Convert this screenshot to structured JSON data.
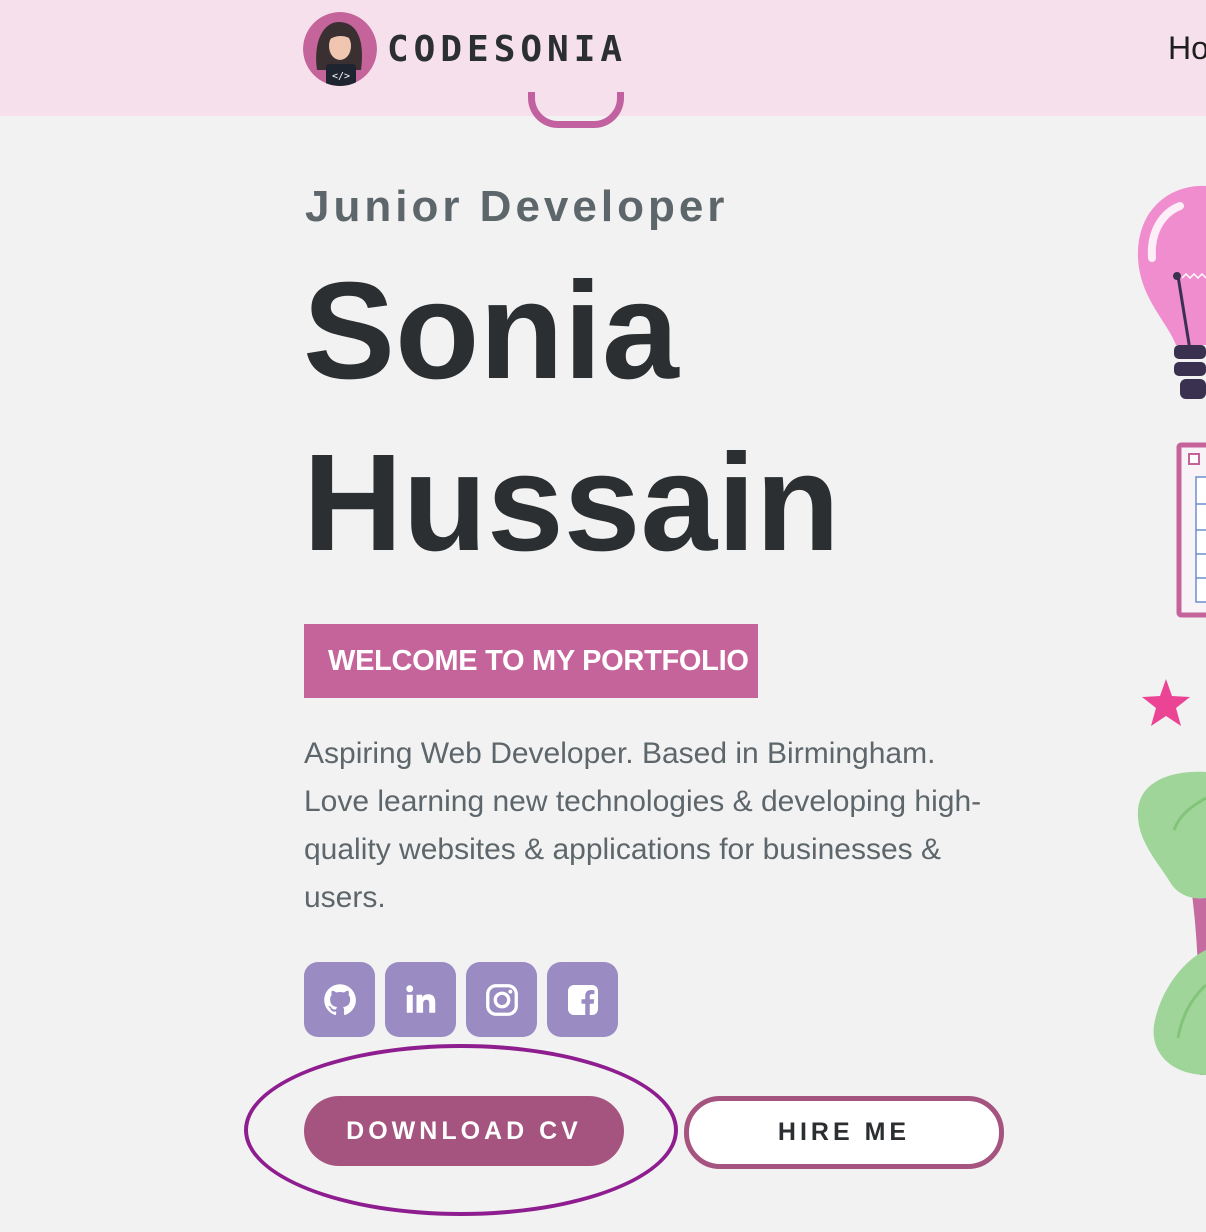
{
  "nav": {
    "brand": "CODESONIA",
    "link_partial": "Ho"
  },
  "hero": {
    "subtitle": "Junior Developer",
    "name_line1": "Sonia",
    "name_line2": "Hussain",
    "welcome_banner": "WELCOME TO MY PORTFOLIO",
    "bio": "Aspiring Web Developer. Based in Birmingham. Love learning new technologies & developing high-quality websites & applications for businesses & users."
  },
  "socials": [
    {
      "icon": "github-icon"
    },
    {
      "icon": "linkedin-icon"
    },
    {
      "icon": "instagram-icon"
    },
    {
      "icon": "facebook-icon"
    }
  ],
  "actions": {
    "download_label": "DOWNLOAD CV",
    "hire_label": "HIRE ME"
  },
  "colors": {
    "navbar_bg": "#f5e0ec",
    "accent_pink": "#c4649a",
    "button_plum": "#a5547f",
    "social_lavender": "#9a8bc3",
    "highlight_purple": "#8e1e8f",
    "text_dark": "#2b2f31",
    "text_gray": "#5d666b"
  }
}
